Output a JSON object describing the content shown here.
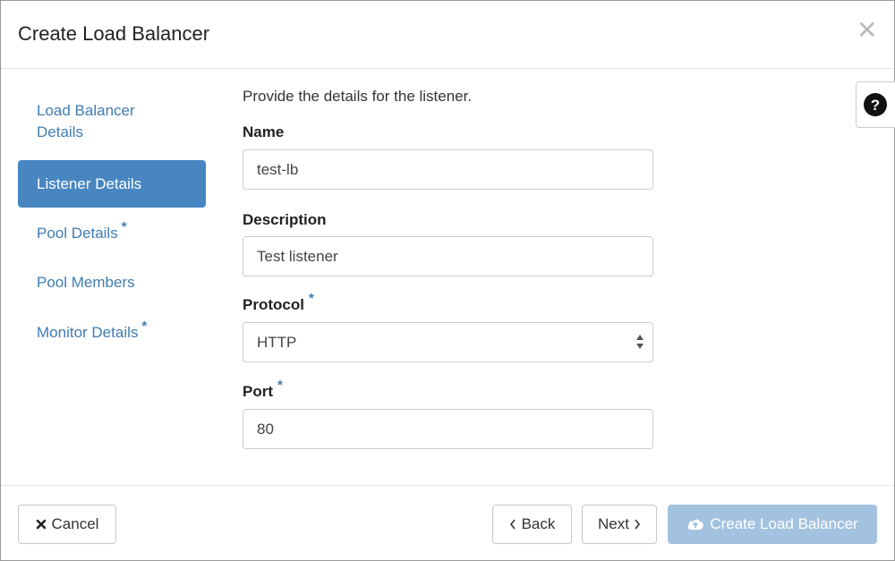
{
  "dialog": {
    "title": "Create Load Balancer"
  },
  "nav": {
    "items": [
      {
        "label_line1": "Load Balancer",
        "label_line2": "Details"
      },
      {
        "label": "Listener Details"
      },
      {
        "label": "Pool Details",
        "required": "*"
      },
      {
        "label": "Pool Members"
      },
      {
        "label": "Monitor Details",
        "required": "*"
      }
    ]
  },
  "form": {
    "intro": "Provide the details for the listener.",
    "name": {
      "label": "Name",
      "value": "test-lb"
    },
    "description": {
      "label": "Description",
      "value": "Test listener"
    },
    "protocol": {
      "label": "Protocol",
      "required": "*",
      "value": "HTTP"
    },
    "port": {
      "label": "Port",
      "required": "*",
      "value": "80"
    }
  },
  "footer": {
    "cancel": "Cancel",
    "back": "Back",
    "next": "Next",
    "create": "Create Load Balancer"
  },
  "colors": {
    "accent": "#4786c1",
    "link": "#3f7cb1",
    "primary_disabled": "#a3c2e0"
  }
}
